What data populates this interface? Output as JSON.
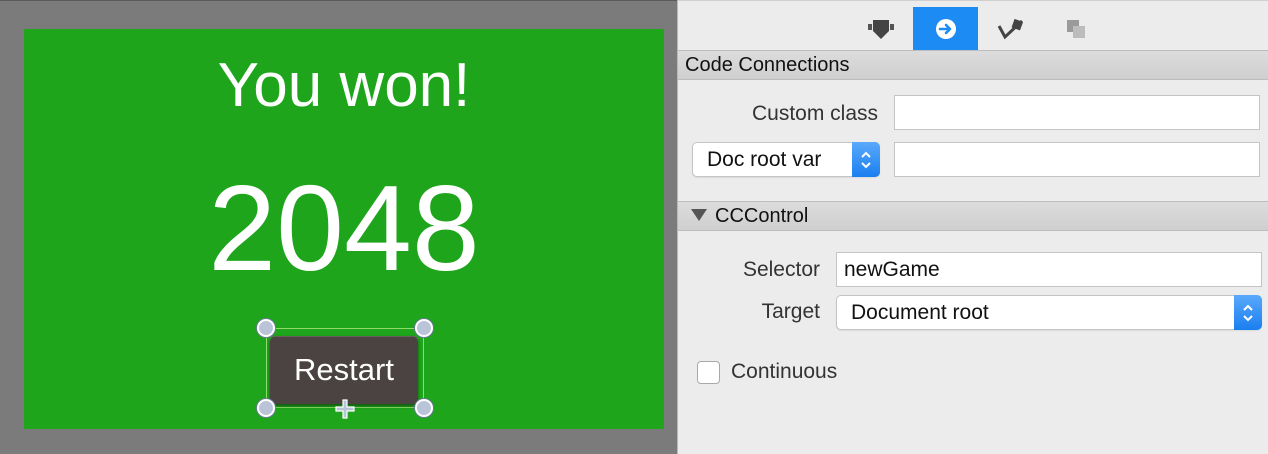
{
  "scene": {
    "win_text": "You won!",
    "score_text": "2048",
    "button_label": "Restart",
    "background_color": "#1ea51c"
  },
  "inspector": {
    "tabs": [
      {
        "icon": "node-properties-icon",
        "active": false
      },
      {
        "icon": "code-connections-icon",
        "active": true
      },
      {
        "icon": "node-physics-icon",
        "active": false
      },
      {
        "icon": "templates-icon",
        "active": false
      }
    ],
    "code_connections": {
      "title": "Code Connections",
      "custom_class_label": "Custom class",
      "custom_class_value": "",
      "owner_select_value": "Doc root var",
      "owner_var_value": ""
    },
    "cccontrol": {
      "title": "CCControl",
      "selector_label": "Selector",
      "selector_value": "newGame",
      "target_label": "Target",
      "target_value": "Document root",
      "continuous_label": "Continuous",
      "continuous_checked": false
    }
  },
  "colors": {
    "accent": "#1c8bf3",
    "scene_green": "#1ea51c",
    "button_dark": "#4a4341"
  }
}
